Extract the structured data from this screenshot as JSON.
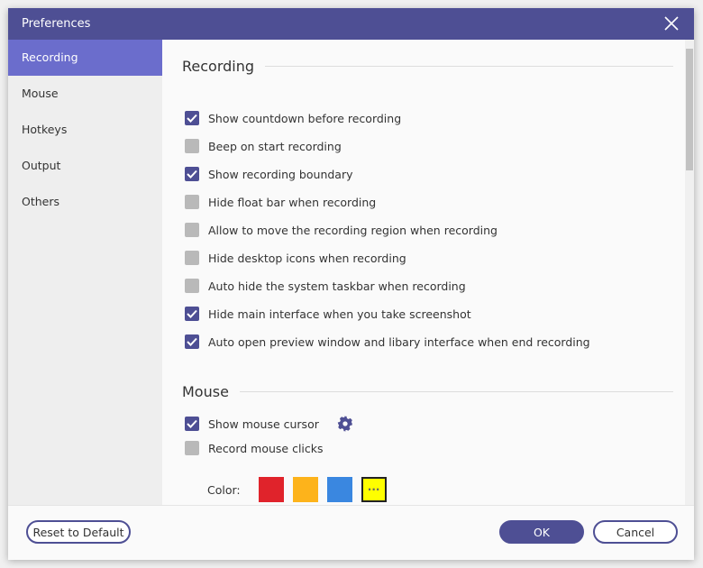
{
  "window": {
    "title": "Preferences"
  },
  "sidebar": {
    "items": [
      {
        "label": "Recording",
        "active": true
      },
      {
        "label": "Mouse"
      },
      {
        "label": "Hotkeys"
      },
      {
        "label": "Output"
      },
      {
        "label": "Others"
      }
    ]
  },
  "recording": {
    "heading": "Recording",
    "options": [
      {
        "label": "Show countdown before recording",
        "checked": true
      },
      {
        "label": "Beep on start recording",
        "checked": false
      },
      {
        "label": "Show recording boundary",
        "checked": true
      },
      {
        "label": "Hide float bar when recording",
        "checked": false
      },
      {
        "label": "Allow to move the recording region when recording",
        "checked": false
      },
      {
        "label": "Hide desktop icons when recording",
        "checked": false
      },
      {
        "label": "Auto hide the system taskbar when recording",
        "checked": false
      },
      {
        "label": "Hide main interface when you take screenshot",
        "checked": true
      },
      {
        "label": "Auto open preview window and libary interface when end recording",
        "checked": true
      }
    ]
  },
  "mouse": {
    "heading": "Mouse",
    "show_cursor": {
      "label": "Show mouse cursor",
      "checked": true,
      "icon": "gear-icon"
    },
    "record_clicks": {
      "label": "Record mouse clicks",
      "checked": false
    },
    "color_label": "Color:",
    "colors": [
      "#e0232b",
      "#fdb31b",
      "#3a87e0",
      "#ffff00"
    ]
  },
  "footer": {
    "reset": "Reset to Default",
    "ok": "OK",
    "cancel": "Cancel"
  },
  "theme": {
    "accent": "#4e4f94",
    "sidebar_active": "#6b6dcc"
  }
}
